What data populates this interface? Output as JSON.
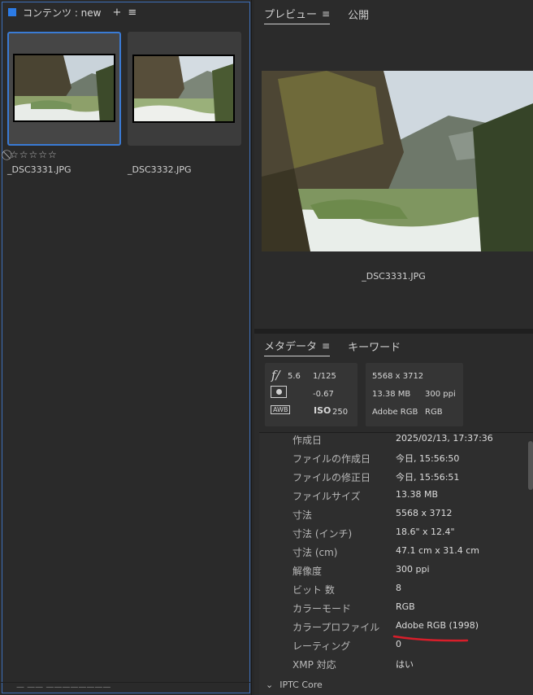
{
  "content_panel": {
    "title": "コンテンツ : new",
    "add_label": "+",
    "menu_label": "≡",
    "thumbnails": [
      {
        "name": "_DSC3331.JPG",
        "rating_icon": "⃠",
        "stars": "☆☆☆☆☆",
        "selected": true
      },
      {
        "name": "_DSC3332.JPG",
        "selected": false
      }
    ],
    "footer_text": "—  ——  ————————"
  },
  "preview_panel": {
    "tabs": [
      {
        "label": "プレビュー",
        "menu": "≡"
      },
      {
        "label": "公開"
      }
    ],
    "caption": "_DSC3331.JPG"
  },
  "metadata_panel": {
    "tabs": [
      {
        "label": "メタデータ",
        "menu": "≡"
      },
      {
        "label": "キーワード"
      }
    ],
    "camera": {
      "aperture_symbol": "f/",
      "aperture": "5.6",
      "shutter": "1/125",
      "exposure_comp": "-0.67",
      "awb_label": "AWB",
      "iso_label": "ISO",
      "iso": "250"
    },
    "file_info": {
      "dimensions": "5568 x 3712",
      "size": "13.38 MB",
      "resolution": "300 ppi",
      "profile": "Adobe RGB",
      "mode": "RGB"
    },
    "rows": [
      {
        "key": "作成日",
        "value": "2025/02/13, 17:37:36"
      },
      {
        "key": "ファイルの作成日",
        "value": "今日, 15:56:50"
      },
      {
        "key": "ファイルの修正日",
        "value": "今日, 15:56:51"
      },
      {
        "key": "ファイルサイズ",
        "value": "13.38 MB"
      },
      {
        "key": "寸法",
        "value": "5568 x 3712"
      },
      {
        "key": "寸法 (インチ)",
        "value": "18.6\" x 12.4\""
      },
      {
        "key": "寸法 (cm)",
        "value": "47.1 cm x 31.4 cm"
      },
      {
        "key": "解像度",
        "value": "300 ppi"
      },
      {
        "key": "ビット 数",
        "value": "8"
      },
      {
        "key": "カラーモード",
        "value": "RGB"
      },
      {
        "key": "カラープロファイル",
        "value": "Adobe RGB (1998)"
      },
      {
        "key": "レーティング",
        "value": "0"
      },
      {
        "key": "XMP 対応",
        "value": "はい"
      }
    ],
    "section_label": "IPTC Core",
    "highlight_color": "#d81e2a"
  }
}
